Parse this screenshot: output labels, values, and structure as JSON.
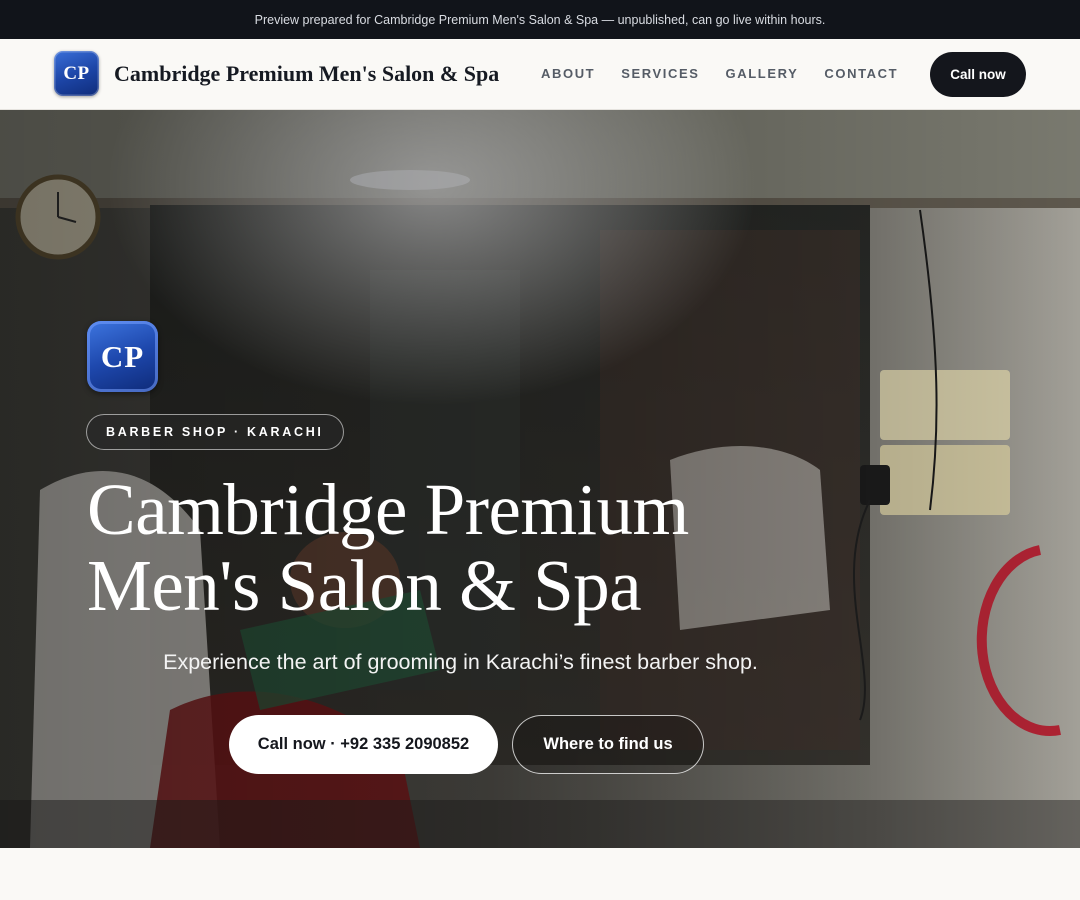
{
  "banner": {
    "text": "Preview prepared for Cambridge Premium Men's Salon & Spa — unpublished, can go live within hours."
  },
  "header": {
    "logo_initials": "CP",
    "brand_name": "Cambridge Premium Men's Salon & Spa",
    "nav": [
      "ABOUT",
      "SERVICES",
      "GALLERY",
      "CONTACT"
    ],
    "cta_label": "Call now"
  },
  "hero": {
    "logo_initials": "CP",
    "tag": "BARBER SHOP · KARACHI",
    "title_line1": "Cambridge Premium",
    "title_line2": "Men's Salon & Spa",
    "subtitle": "Experience the art of grooming in Karachi’s finest barber shop.",
    "primary_button": "Call now · +92 335 2090852",
    "secondary_button": "Where to find us"
  },
  "colors": {
    "banner_bg": "#11141a",
    "nav_bg": "#faf9f6",
    "cta_bg": "#14161c",
    "logo_blue": "#1d46a8",
    "hero_text": "#ffffff"
  }
}
